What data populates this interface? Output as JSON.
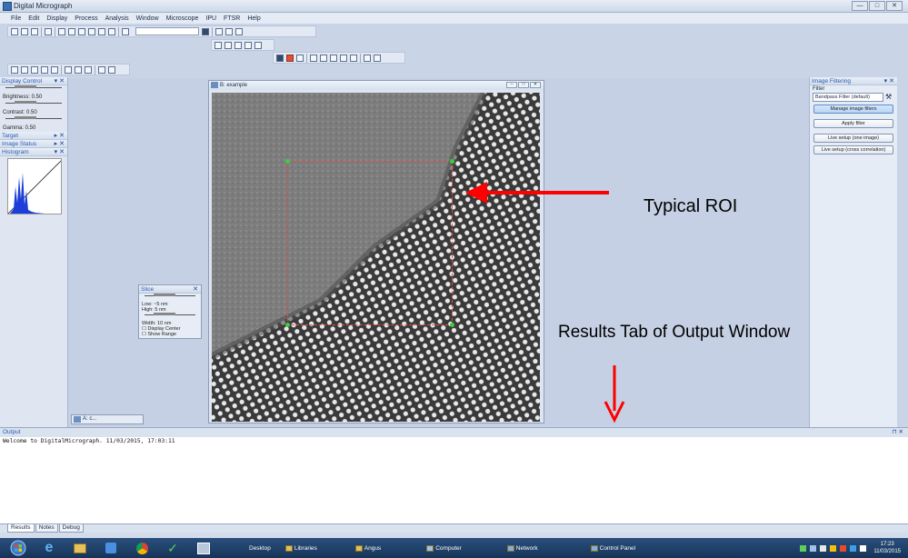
{
  "window": {
    "title": "Digital Micrograph",
    "controls": [
      "—",
      "□",
      "✕"
    ]
  },
  "menu": [
    "File",
    "Edit",
    "Display",
    "Process",
    "Analysis",
    "Window",
    "Microscope",
    "IPU",
    "FTSR",
    "Help"
  ],
  "left_panel": {
    "display_control": {
      "title": "Display Control",
      "brightness": "Brightness: 0.50",
      "contrast": "Contrast: 0.50",
      "gamma": "Gamma: 0.50"
    },
    "target": {
      "title": "Target"
    },
    "image_status": {
      "title": "Image Status"
    },
    "histogram": {
      "title": "Histogram"
    }
  },
  "image_window": {
    "title": "B: example"
  },
  "minimized_window": {
    "title": "A: c..."
  },
  "slice": {
    "title": "Slice",
    "low": "Low: ~5 nm",
    "high": "High: 5 nm",
    "width": "Width: 10 nm",
    "display_center": "Display Center",
    "show_range": "Show Range"
  },
  "right_panel": {
    "title": "Image Filtering",
    "filter_label": "Filter",
    "filter_value": "Bandpass Filter (default)",
    "buttons": {
      "manage": "Manage image filters",
      "apply": "Apply filter",
      "live_one": "Live setup (one image)",
      "live_cross": "Live setup (cross correlation)"
    }
  },
  "annotations": {
    "roi": "Typical ROI",
    "results": "Results Tab of Output Window"
  },
  "output": {
    "title": "Output",
    "text": "Welcome to DigitalMicrograph.  11/03/2015, 17:03:11",
    "tabs": [
      "Results",
      "Notes",
      "Debug"
    ]
  },
  "taskbar": {
    "items": [
      "Desktop",
      "Libraries",
      "Angus",
      "Computer",
      "Network",
      "Control Panel"
    ],
    "time": "17:23",
    "date": "11/03/2015"
  },
  "colors": {
    "accent": "#2a5fb0",
    "roi": "#e35050",
    "arrow": "#ff0000",
    "handle": "#3ccf3c"
  }
}
